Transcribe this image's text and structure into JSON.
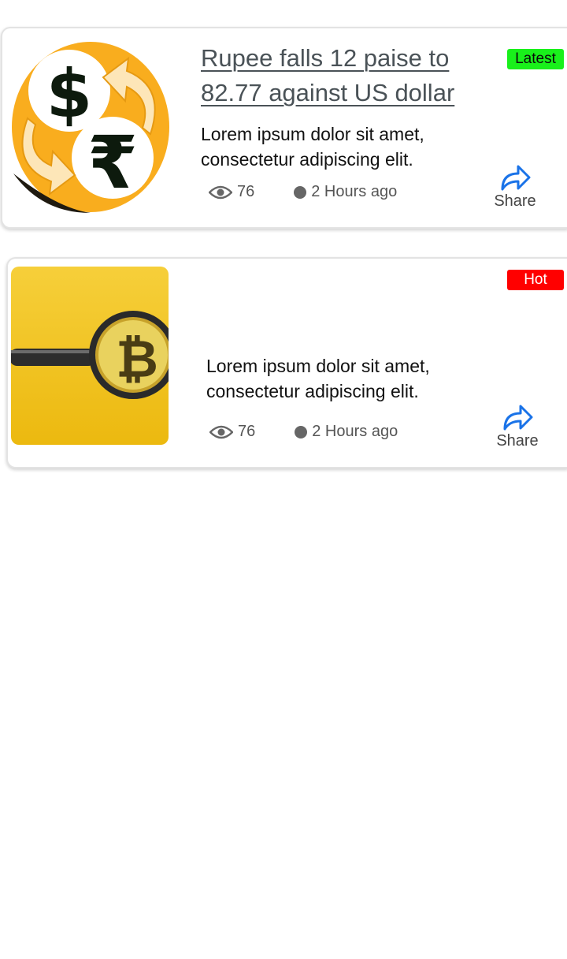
{
  "articles": [
    {
      "title": "Rupee falls 12 paise to\n 82.77 against US dollar",
      "description": "Lorem ipsum dolor sit amet, consectetur adipiscing elit.",
      "views": "76",
      "time": "2 Hours ago",
      "badge": "Latest",
      "badge_color": "#19f01b",
      "share_label": "Share",
      "thumbnail_icon": "dollar-rupee-exchange-icon"
    },
    {
      "title": "",
      "description": "Lorem ipsum dolor sit amet, consectetur adipiscing elit.",
      "views": "76",
      "time": "2 Hours ago",
      "badge": "Hot",
      "badge_color": "#ff0000",
      "share_label": "Share",
      "thumbnail_icon": "bitcoin-magnifier-image"
    }
  ],
  "colors": {
    "share_icon": "#1a73e8",
    "accent_orange": "#f9ad1e",
    "accent_yellow": "#f4c92a"
  }
}
